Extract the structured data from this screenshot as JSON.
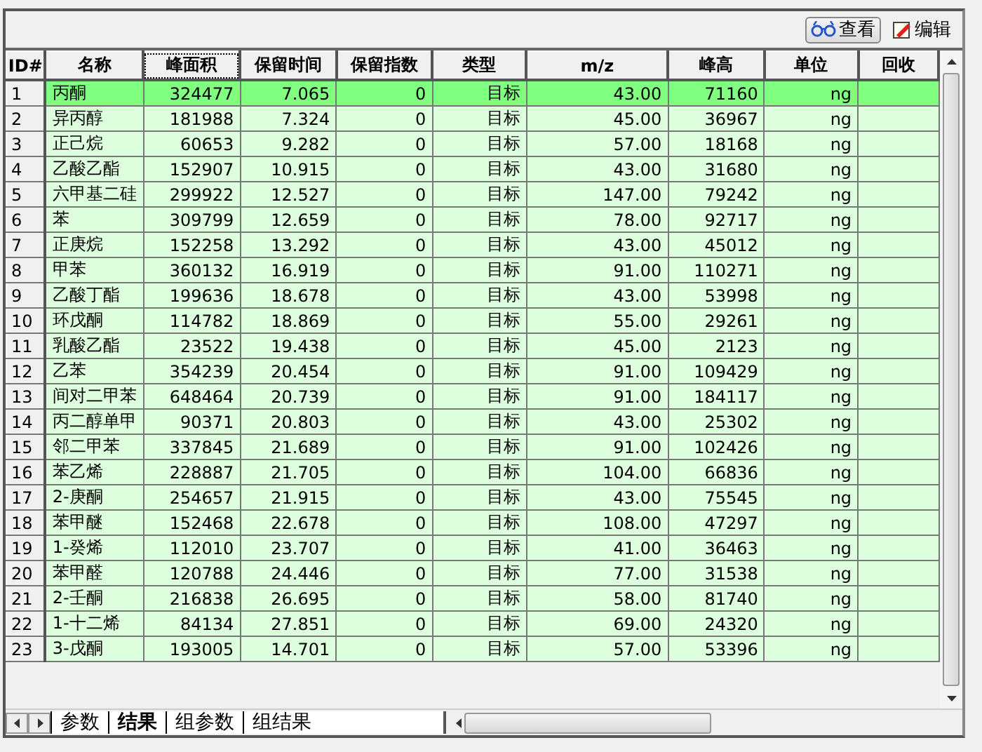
{
  "toolbar": {
    "buttons": [
      {
        "label": "查看",
        "pressed": true,
        "kind": "view"
      },
      {
        "label": "编辑",
        "pressed": false,
        "kind": "edit"
      }
    ]
  },
  "table": {
    "columns": [
      {
        "label": "ID#",
        "focused": false
      },
      {
        "label": "名称",
        "focused": false
      },
      {
        "label": "峰面积",
        "focused": true
      },
      {
        "label": "保留时间",
        "focused": false
      },
      {
        "label": "保留指数",
        "focused": false
      },
      {
        "label": "类型",
        "focused": false
      },
      {
        "label": "m/z",
        "focused": false
      },
      {
        "label": "峰高",
        "focused": false
      },
      {
        "label": "单位",
        "focused": false
      },
      {
        "label": "回收",
        "focused": false
      }
    ],
    "rows": [
      {
        "selected": true,
        "cells": [
          "1",
          "丙酮",
          "324477",
          "7.065",
          "0",
          "目标",
          "43.00",
          "71160",
          "ng"
        ]
      },
      {
        "selected": false,
        "cells": [
          "2",
          "异丙醇",
          "181988",
          "7.324",
          "0",
          "目标",
          "45.00",
          "36967",
          "ng"
        ]
      },
      {
        "selected": false,
        "cells": [
          "3",
          "正己烷",
          "60653",
          "9.282",
          "0",
          "目标",
          "57.00",
          "18168",
          "ng"
        ]
      },
      {
        "selected": false,
        "cells": [
          "4",
          "乙酸乙酯",
          "152907",
          "10.915",
          "0",
          "目标",
          "43.00",
          "31680",
          "ng"
        ]
      },
      {
        "selected": false,
        "cells": [
          "5",
          "六甲基二硅",
          "299922",
          "12.527",
          "0",
          "目标",
          "147.00",
          "79242",
          "ng"
        ]
      },
      {
        "selected": false,
        "cells": [
          "6",
          "苯",
          "309799",
          "12.659",
          "0",
          "目标",
          "78.00",
          "92717",
          "ng"
        ]
      },
      {
        "selected": false,
        "cells": [
          "7",
          "正庚烷",
          "152258",
          "13.292",
          "0",
          "目标",
          "43.00",
          "45012",
          "ng"
        ]
      },
      {
        "selected": false,
        "cells": [
          "8",
          "甲苯",
          "360132",
          "16.919",
          "0",
          "目标",
          "91.00",
          "110271",
          "ng"
        ]
      },
      {
        "selected": false,
        "cells": [
          "9",
          "乙酸丁酯",
          "199636",
          "18.678",
          "0",
          "目标",
          "43.00",
          "53998",
          "ng"
        ]
      },
      {
        "selected": false,
        "cells": [
          "10",
          "环戊酮",
          "114782",
          "18.869",
          "0",
          "目标",
          "55.00",
          "29261",
          "ng"
        ]
      },
      {
        "selected": false,
        "cells": [
          "11",
          "乳酸乙酯",
          "23522",
          "19.438",
          "0",
          "目标",
          "45.00",
          "2123",
          "ng"
        ]
      },
      {
        "selected": false,
        "cells": [
          "12",
          "乙苯",
          "354239",
          "20.454",
          "0",
          "目标",
          "91.00",
          "109429",
          "ng"
        ]
      },
      {
        "selected": false,
        "cells": [
          "13",
          "间对二甲苯",
          "648464",
          "20.739",
          "0",
          "目标",
          "91.00",
          "184117",
          "ng"
        ]
      },
      {
        "selected": false,
        "cells": [
          "14",
          "丙二醇单甲",
          "90371",
          "20.803",
          "0",
          "目标",
          "43.00",
          "25302",
          "ng"
        ]
      },
      {
        "selected": false,
        "cells": [
          "15",
          "邻二甲苯",
          "337845",
          "21.689",
          "0",
          "目标",
          "91.00",
          "102426",
          "ng"
        ]
      },
      {
        "selected": false,
        "cells": [
          "16",
          "苯乙烯",
          "228887",
          "21.705",
          "0",
          "目标",
          "104.00",
          "66836",
          "ng"
        ]
      },
      {
        "selected": false,
        "cells": [
          "17",
          "2-庚酮",
          "254657",
          "21.915",
          "0",
          "目标",
          "43.00",
          "75545",
          "ng"
        ]
      },
      {
        "selected": false,
        "cells": [
          "18",
          "苯甲醚",
          "152468",
          "22.678",
          "0",
          "目标",
          "108.00",
          "47297",
          "ng"
        ]
      },
      {
        "selected": false,
        "cells": [
          "19",
          "1-癸烯",
          "112010",
          "23.707",
          "0",
          "目标",
          "41.00",
          "36463",
          "ng"
        ]
      },
      {
        "selected": false,
        "cells": [
          "20",
          "苯甲醛",
          "120788",
          "24.446",
          "0",
          "目标",
          "77.00",
          "31538",
          "ng"
        ]
      },
      {
        "selected": false,
        "cells": [
          "21",
          "2-壬酮",
          "216838",
          "26.695",
          "0",
          "目标",
          "58.00",
          "81740",
          "ng"
        ]
      },
      {
        "selected": false,
        "cells": [
          "22",
          "1-十二烯",
          "84134",
          "27.851",
          "0",
          "目标",
          "69.00",
          "24320",
          "ng"
        ]
      },
      {
        "selected": false,
        "cells": [
          "23",
          "3-戊酮",
          "193005",
          "14.701",
          "0",
          "目标",
          "57.00",
          "53396",
          "ng"
        ]
      }
    ]
  },
  "sheet_tabs": [
    {
      "label": "参数",
      "selected": false
    },
    {
      "label": "结果",
      "selected": true
    },
    {
      "label": "组参数",
      "selected": false
    },
    {
      "label": "组结果",
      "selected": false
    }
  ]
}
